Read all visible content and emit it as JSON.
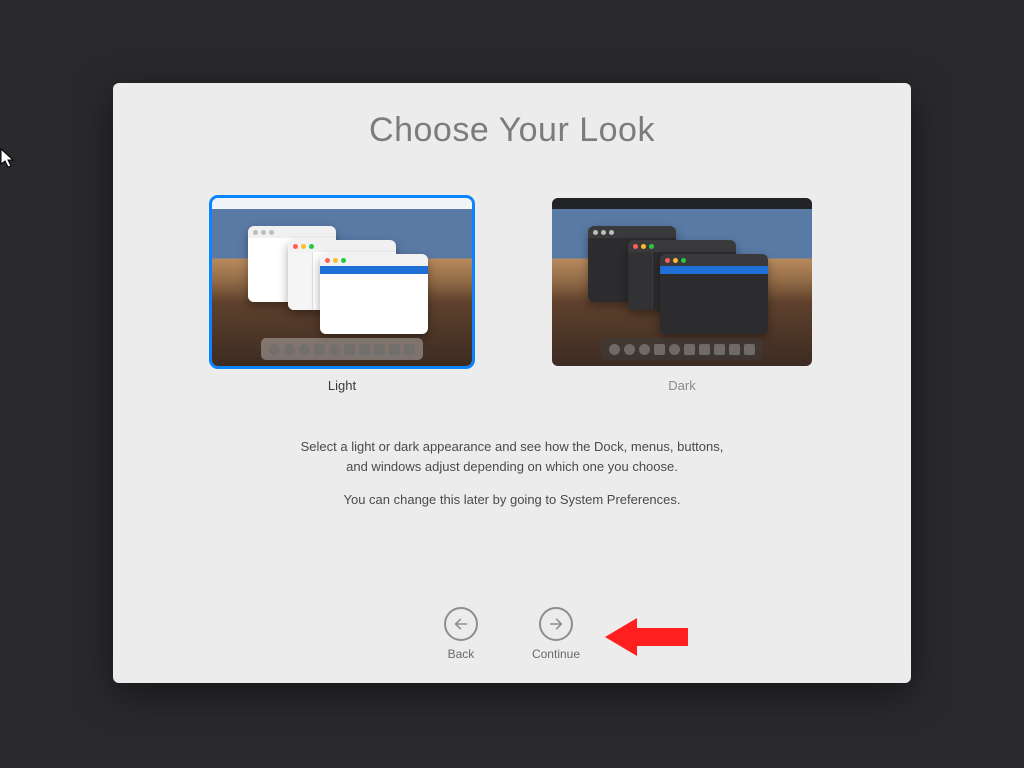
{
  "title": "Choose Your Look",
  "options": {
    "light": {
      "label": "Light",
      "selected": true
    },
    "dark": {
      "label": "Dark",
      "selected": false
    }
  },
  "description": {
    "line1": "Select a light or dark appearance and see how the Dock, menus, buttons,",
    "line2": "and windows adjust depending on which one you choose.",
    "line3": "You can change this later by going to System Preferences."
  },
  "nav": {
    "back": "Back",
    "continue": "Continue"
  }
}
